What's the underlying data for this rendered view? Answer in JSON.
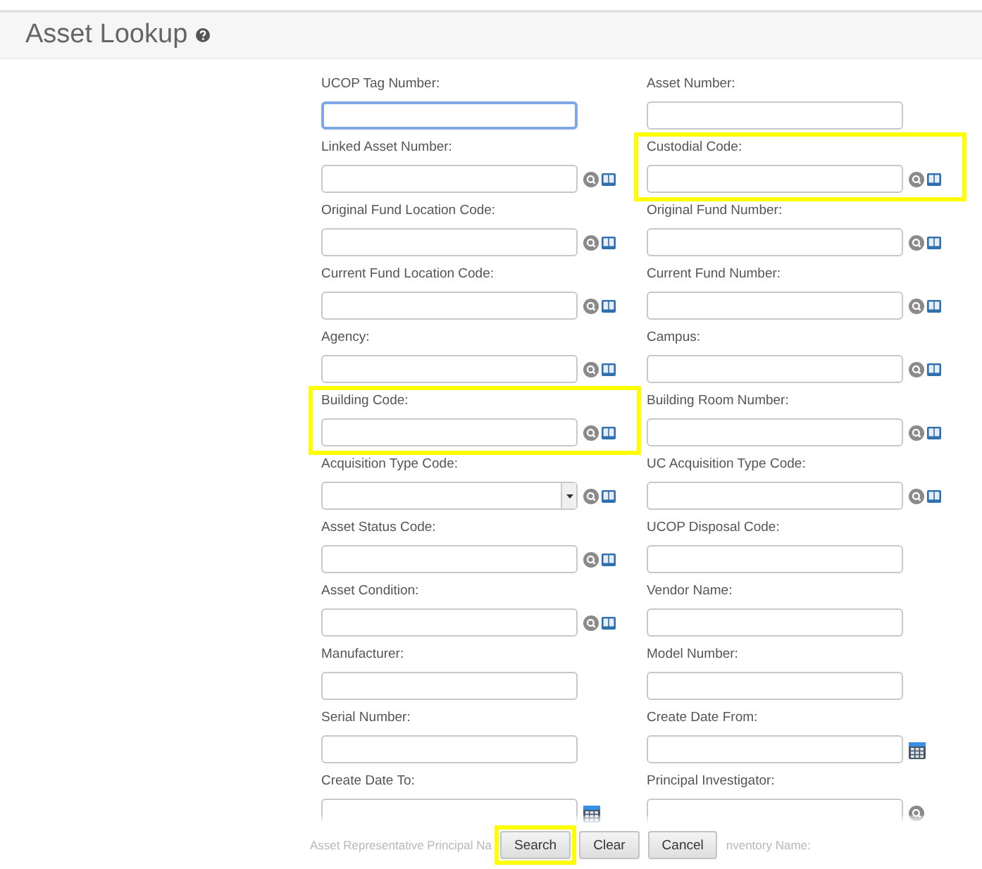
{
  "title": "Asset Lookup",
  "fields": [
    {
      "label": "UCOP Tag Number:",
      "kind": "text",
      "focused": true,
      "highlighted": false
    },
    {
      "label": "Asset Number:",
      "kind": "text",
      "focused": false,
      "highlighted": false
    },
    {
      "label": "Linked Asset Number:",
      "kind": "lookup",
      "focused": false,
      "highlighted": false
    },
    {
      "label": "Custodial Code:",
      "kind": "lookup",
      "focused": false,
      "highlighted": true
    },
    {
      "label": "Original Fund Location Code:",
      "kind": "lookup",
      "focused": false,
      "highlighted": false
    },
    {
      "label": "Original Fund Number:",
      "kind": "lookup",
      "focused": false,
      "highlighted": false
    },
    {
      "label": "Current Fund Location Code:",
      "kind": "lookup",
      "focused": false,
      "highlighted": false
    },
    {
      "label": "Current Fund Number:",
      "kind": "lookup",
      "focused": false,
      "highlighted": false
    },
    {
      "label": "Agency:",
      "kind": "lookup",
      "focused": false,
      "highlighted": false
    },
    {
      "label": "Campus:",
      "kind": "lookup",
      "focused": false,
      "highlighted": false
    },
    {
      "label": "Building Code:",
      "kind": "lookup",
      "focused": false,
      "highlighted": true
    },
    {
      "label": "Building Room Number:",
      "kind": "lookup",
      "focused": false,
      "highlighted": false
    },
    {
      "label": "Acquisition Type Code:",
      "kind": "select",
      "focused": false,
      "highlighted": false
    },
    {
      "label": "UC Acquisition Type Code:",
      "kind": "lookup",
      "focused": false,
      "highlighted": false
    },
    {
      "label": "Asset Status Code:",
      "kind": "lookup",
      "focused": false,
      "highlighted": false
    },
    {
      "label": "UCOP Disposal Code:",
      "kind": "text",
      "focused": false,
      "highlighted": false
    },
    {
      "label": "Asset Condition:",
      "kind": "lookup",
      "focused": false,
      "highlighted": false
    },
    {
      "label": "Vendor Name:",
      "kind": "text",
      "focused": false,
      "highlighted": false
    },
    {
      "label": "Manufacturer:",
      "kind": "text",
      "focused": false,
      "highlighted": false
    },
    {
      "label": "Model Number:",
      "kind": "text",
      "focused": false,
      "highlighted": false
    },
    {
      "label": "Serial Number:",
      "kind": "text",
      "focused": false,
      "highlighted": false
    },
    {
      "label": "Create Date From:",
      "kind": "date",
      "focused": false,
      "highlighted": false
    },
    {
      "label": "Create Date To:",
      "kind": "date",
      "focused": false,
      "highlighted": false
    },
    {
      "label": "Principal Investigator:",
      "kind": "search",
      "focused": false,
      "highlighted": false
    }
  ],
  "hidden_labels": [
    "Asset Representative Principal Na",
    "nventory Name:"
  ],
  "buttons": [
    {
      "label": "Search",
      "highlighted": true
    },
    {
      "label": "Clear",
      "highlighted": false
    },
    {
      "label": "Cancel",
      "highlighted": false
    }
  ]
}
